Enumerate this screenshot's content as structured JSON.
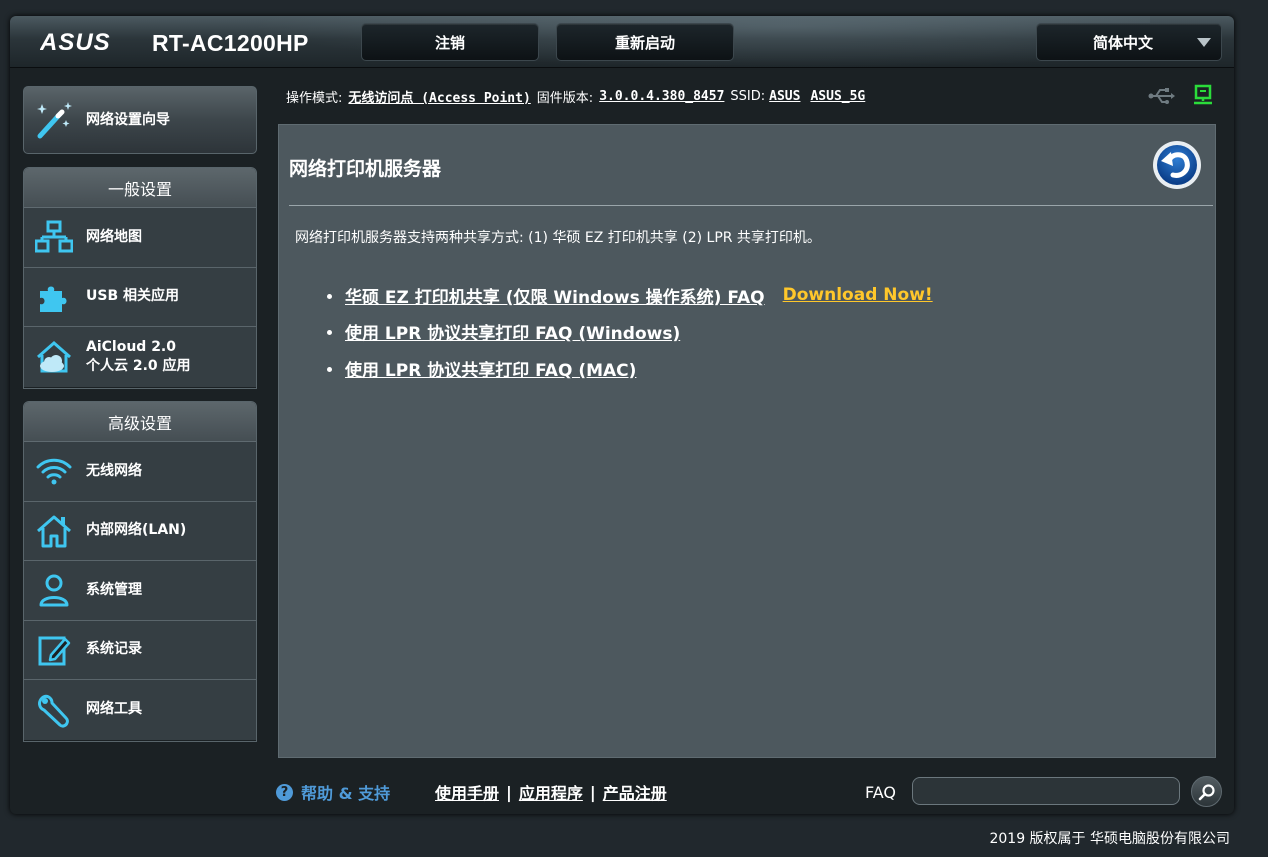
{
  "header": {
    "brand": "ASUS",
    "model": "RT-AC1200HP",
    "logout_label": "注销",
    "reboot_label": "重新启动",
    "language_label": "简体中文"
  },
  "status": {
    "mode_label": "操作模式:",
    "mode_value": "无线访问点 (Access Point)",
    "firmware_label": "固件版本:",
    "firmware_value": "3.0.0.4.380_8457",
    "ssid_label": "SSID:",
    "ssid_values": [
      "ASUS",
      "ASUS_5G"
    ]
  },
  "sidebar": {
    "wizard_label": "网络设置向导",
    "general": {
      "title": "一般设置",
      "items": [
        {
          "label": "网络地图",
          "icon": "network-map-icon"
        },
        {
          "label": "USB 相关应用",
          "icon": "puzzle-icon"
        },
        {
          "label": "AiCloud 2.0",
          "label2": "个人云 2.0 应用",
          "icon": "aicloud-icon"
        }
      ]
    },
    "advanced": {
      "title": "高级设置",
      "items": [
        {
          "label": "无线网络",
          "icon": "wifi-icon"
        },
        {
          "label": "内部网络(LAN)",
          "icon": "house-icon"
        },
        {
          "label": "系统管理",
          "icon": "user-admin-icon"
        },
        {
          "label": "系统记录",
          "icon": "log-edit-icon"
        },
        {
          "label": "网络工具",
          "icon": "wrench-icon"
        }
      ]
    }
  },
  "panel": {
    "title": "网络打印机服务器",
    "description": "网络打印机服务器支持两种共享方式: (1) 华硕 EZ 打印机共享 (2) LPR 共享打印机。",
    "links": [
      {
        "label": "华硕 EZ 打印机共享 (仅限 Windows 操作系统) FAQ",
        "extra": "Download Now!"
      },
      {
        "label": "使用 LPR 协议共享打印 FAQ (Windows)"
      },
      {
        "label": "使用 LPR 协议共享打印 FAQ (MAC)"
      }
    ]
  },
  "footer": {
    "help_label": "帮助 & 支持",
    "links": [
      "使用手册",
      "应用程序",
      "产品注册"
    ],
    "faq_label": "FAQ",
    "faq_value": "",
    "copyright": "2019 版权属于 华硕电脑股份有限公司"
  },
  "colors": {
    "accent_link": "#ffc72b",
    "help_blue": "#4f9ad8",
    "icon_cyan": "#3fc6f0",
    "status_green": "#2bdc3a",
    "panel_bg": "#4d585e"
  }
}
